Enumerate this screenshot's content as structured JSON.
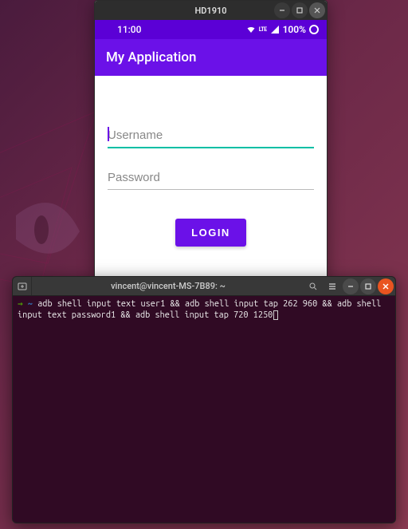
{
  "android_window": {
    "title": "HD1910",
    "statusbar": {
      "time": "11:00",
      "lte_label": "LTE",
      "battery_percent": "100%"
    },
    "appbar_title": "My Application",
    "username_placeholder": "Username",
    "username_value": "",
    "password_placeholder": "Password",
    "password_value": "",
    "login_label": "LOGIN"
  },
  "terminal_window": {
    "title": "vincent@vincent-MS-7B89: ~",
    "prompt_arrow": "→ ",
    "prompt_tilde": "~",
    "command": " adb shell input text user1 && adb shell input tap 262 960 && adb shell input text password1 && adb shell input tap 720 1250"
  }
}
